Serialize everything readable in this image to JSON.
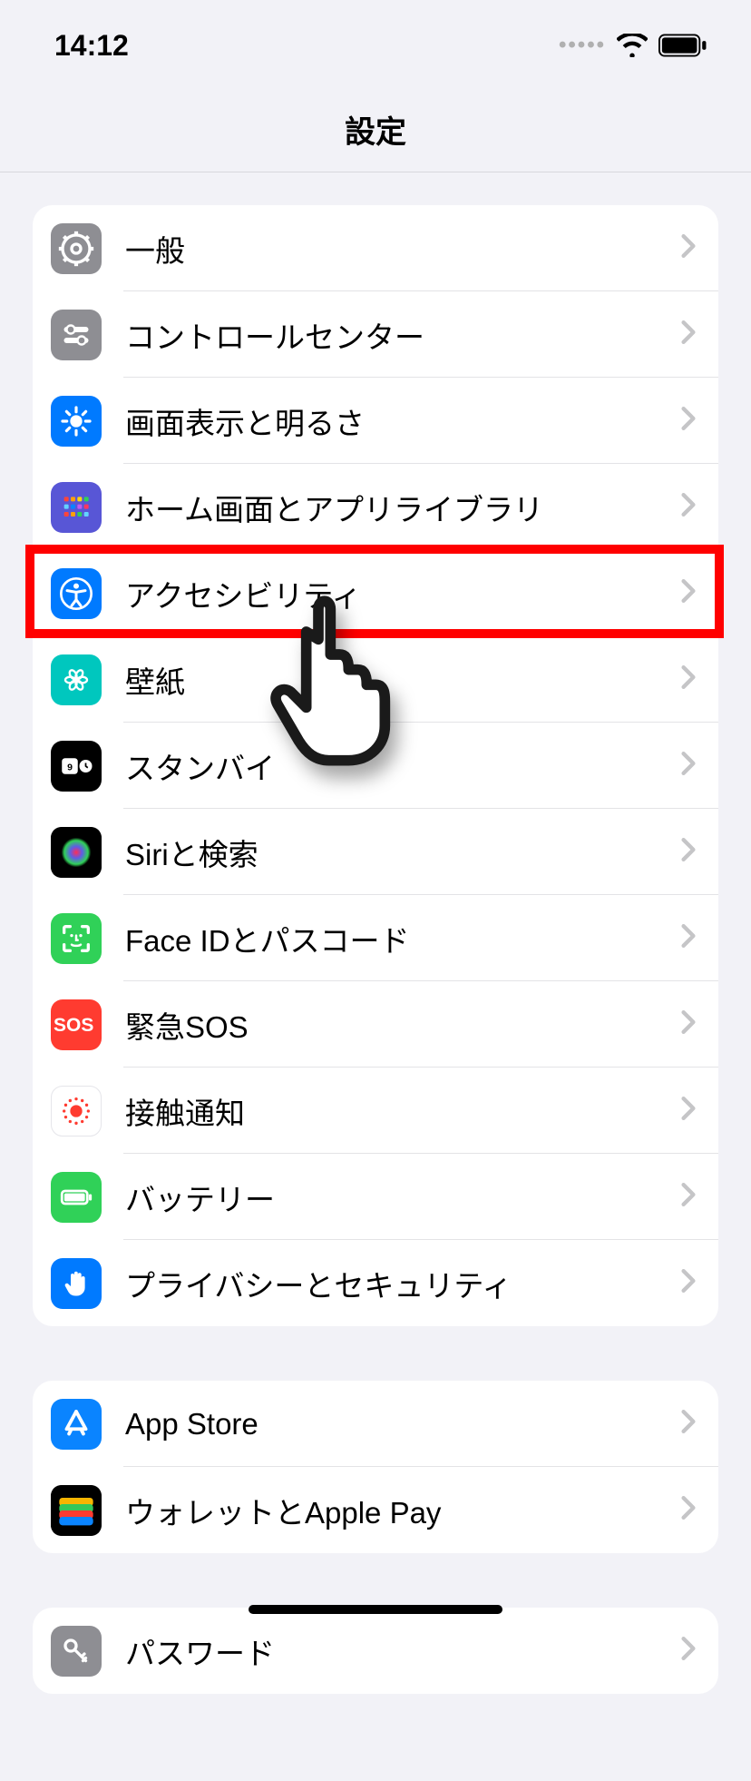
{
  "status": {
    "time": "14:12"
  },
  "title": "設定",
  "groups": [
    {
      "rows": [
        {
          "id": "general",
          "label": "一般",
          "icon": "gear",
          "bg": "#8e8e93"
        },
        {
          "id": "controlcenter",
          "label": "コントロールセンター",
          "icon": "sliders",
          "bg": "#8e8e93"
        },
        {
          "id": "display",
          "label": "画面表示と明るさ",
          "icon": "sun",
          "bg": "#007aff"
        },
        {
          "id": "home",
          "label": "ホーム画面とアプリライブラリ",
          "icon": "grid",
          "bg": "#5856d6"
        },
        {
          "id": "accessibility",
          "label": "アクセシビリティ",
          "icon": "accessibility",
          "bg": "#007aff",
          "highlighted": true
        },
        {
          "id": "wallpaper",
          "label": "壁紙",
          "icon": "flower",
          "bg": "#00c7be"
        },
        {
          "id": "standby",
          "label": "スタンバイ",
          "icon": "clock",
          "bg": "#000000"
        },
        {
          "id": "siri",
          "label": "Siriと検索",
          "icon": "siri",
          "bg": "#000000"
        },
        {
          "id": "faceid",
          "label": "Face IDとパスコード",
          "icon": "face",
          "bg": "#30d158"
        },
        {
          "id": "sos",
          "label": "緊急SOS",
          "icon": "sos",
          "bg": "#ff3b30"
        },
        {
          "id": "exposure",
          "label": "接触通知",
          "icon": "exposure",
          "bg": "#ffffff"
        },
        {
          "id": "battery",
          "label": "バッテリー",
          "icon": "battery",
          "bg": "#30d158"
        },
        {
          "id": "privacy",
          "label": "プライバシーとセキュリティ",
          "icon": "hand",
          "bg": "#007aff"
        }
      ]
    },
    {
      "rows": [
        {
          "id": "appstore",
          "label": "App Store",
          "icon": "appstore",
          "bg": "#0a84ff"
        },
        {
          "id": "wallet",
          "label": "ウォレットとApple Pay",
          "icon": "wallet",
          "bg": "#000000"
        }
      ]
    },
    {
      "rows": [
        {
          "id": "passwords",
          "label": "パスワード",
          "icon": "key",
          "bg": "#8e8e93"
        }
      ]
    }
  ]
}
